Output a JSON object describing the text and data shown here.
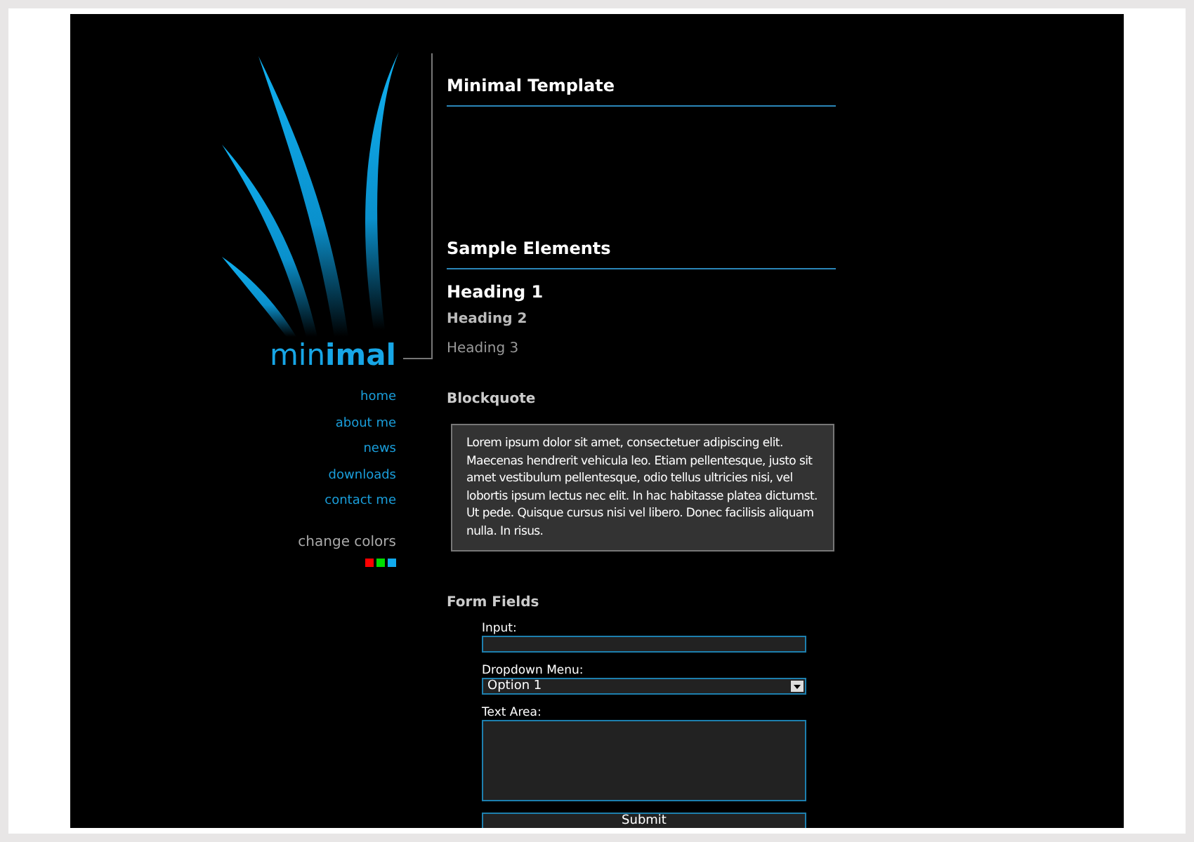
{
  "logo": {
    "text": "min**imal**"
  },
  "nav": [
    {
      "label": "home"
    },
    {
      "label": "about me"
    },
    {
      "label": "news"
    },
    {
      "label": "downloads"
    },
    {
      "label": "contact me"
    }
  ],
  "change_colors": {
    "label": "change colors",
    "swatches": [
      {
        "color": "#ff0000"
      },
      {
        "color": "#00dd00"
      },
      {
        "color": "#11aaee"
      }
    ]
  },
  "sections": [
    {
      "title": "Minimal Template"
    },
    {
      "title": "Sample Elements"
    }
  ],
  "headings": [
    {
      "kind": "h1",
      "text": "Heading 1"
    },
    {
      "kind": "h2",
      "text": "Heading 2"
    },
    {
      "kind": "h3",
      "text": "Heading 3"
    }
  ],
  "blockquote": {
    "title": "Blockquote",
    "text": "Lorem ipsum dolor sit amet, consectetuer adipiscing elit. Maecenas hendrerit vehicula leo. Etiam pellentesque, justo sit amet vestibulum pellentesque, odio tellus ultricies nisi, vel lobortis ipsum lectus nec elit. In hac habitasse platea dictumst. Ut pede. Quisque cursus nisi vel libero. Donec facilisis aliquam nulla. In risus."
  },
  "form": {
    "title": "Form Fields",
    "fields": [
      {
        "kind": "input",
        "label": "Input:"
      },
      {
        "kind": "select",
        "label": "Dropdown Menu:",
        "value": "Option 1"
      },
      {
        "kind": "textarea",
        "label": "Text Area:"
      }
    ],
    "submit": "Submit"
  }
}
